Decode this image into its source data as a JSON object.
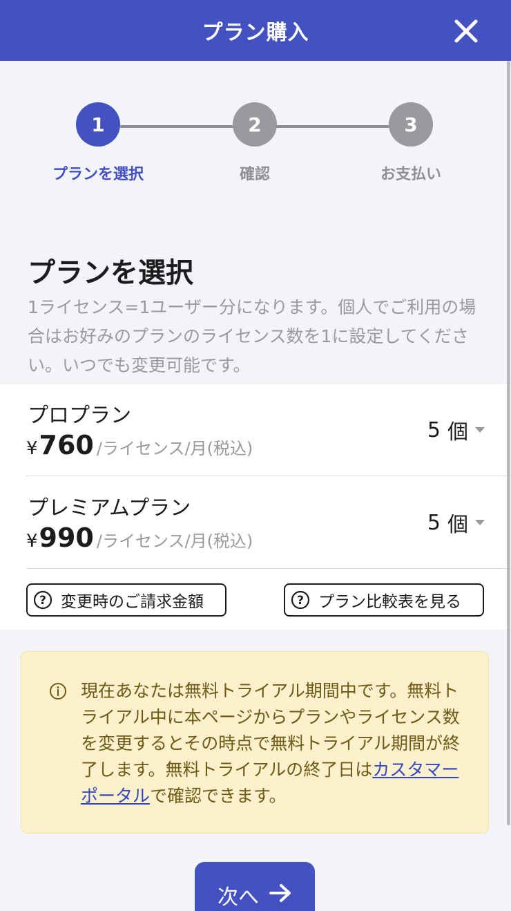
{
  "header": {
    "title": "プラン購入"
  },
  "stepper": {
    "steps": [
      {
        "number": "1",
        "label": "プランを選択"
      },
      {
        "number": "2",
        "label": "確認"
      },
      {
        "number": "3",
        "label": "お支払い"
      }
    ]
  },
  "main": {
    "title": "プランを選択",
    "description": "1ライセンス=1ユーザー分になります。個人でご利用の場合はお好みのプランのライセンス数を1に設定してください。いつでも変更可能です。"
  },
  "plans": [
    {
      "name": "プロプラン",
      "currency": "¥",
      "price": "760",
      "unit": "/ライセンス/月(税込)",
      "quantity": "5",
      "quantity_unit": "個"
    },
    {
      "name": "プレミアムプラン",
      "currency": "¥",
      "price": "990",
      "unit": "/ライセンス/月(税込)",
      "quantity": "5",
      "quantity_unit": "個"
    }
  ],
  "buttons": {
    "billing_amount": "変更時のご請求金額",
    "compare_plans": "プラン比較表を見る",
    "next": "次へ"
  },
  "notice": {
    "text_before": "現在あなたは無料トライアル期間中です。無料トライアル中に本ページからプランやライセンス数を変更するとその時点で無料トライアル期間が終了します。無料トライアルの終了日は",
    "link": "カスタマーポータル",
    "text_after": "で確認できます。"
  },
  "colors": {
    "primary": "#4351c1",
    "notice_bg": "#fcf1cc",
    "notice_text": "#6e5a15",
    "muted": "#9a9a9e"
  }
}
